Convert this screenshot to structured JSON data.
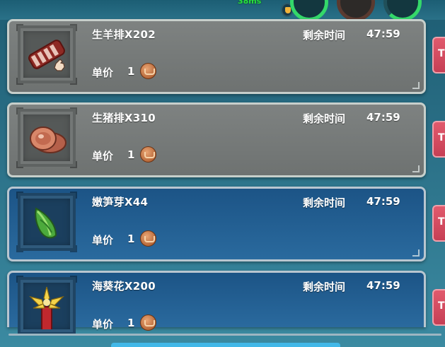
{
  "hud": {
    "ping": "38ms"
  },
  "listings": [
    {
      "name": "生羊排X202",
      "time_label": "剩余时间",
      "time": "47:59",
      "price_label": "单价",
      "price": "1",
      "icon": "raw-lamb-chop-icon",
      "theme": "gray"
    },
    {
      "name": "生猪排X310",
      "time_label": "剩余时间",
      "time": "47:59",
      "price_label": "单价",
      "price": "1",
      "icon": "raw-pork-chop-icon",
      "theme": "gray"
    },
    {
      "name": "嫩笋芽X44",
      "time_label": "剩余时间",
      "time": "47:59",
      "price_label": "单价",
      "price": "1",
      "icon": "bamboo-shoot-icon",
      "theme": "blue"
    },
    {
      "name": "海葵花X200",
      "time_label": "剩余时间",
      "time": "47:59",
      "price_label": "单价",
      "price": "1",
      "icon": "sea-anemone-icon",
      "theme": "blue"
    }
  ],
  "side_buttons": [
    "T",
    "T",
    "T",
    "T"
  ],
  "colors": {
    "gray_card": "#7e8281",
    "blue_card": "#1c5486",
    "coin": "#b8693a",
    "side_button": "#e15a6d",
    "ping_text": "#26e23f"
  }
}
